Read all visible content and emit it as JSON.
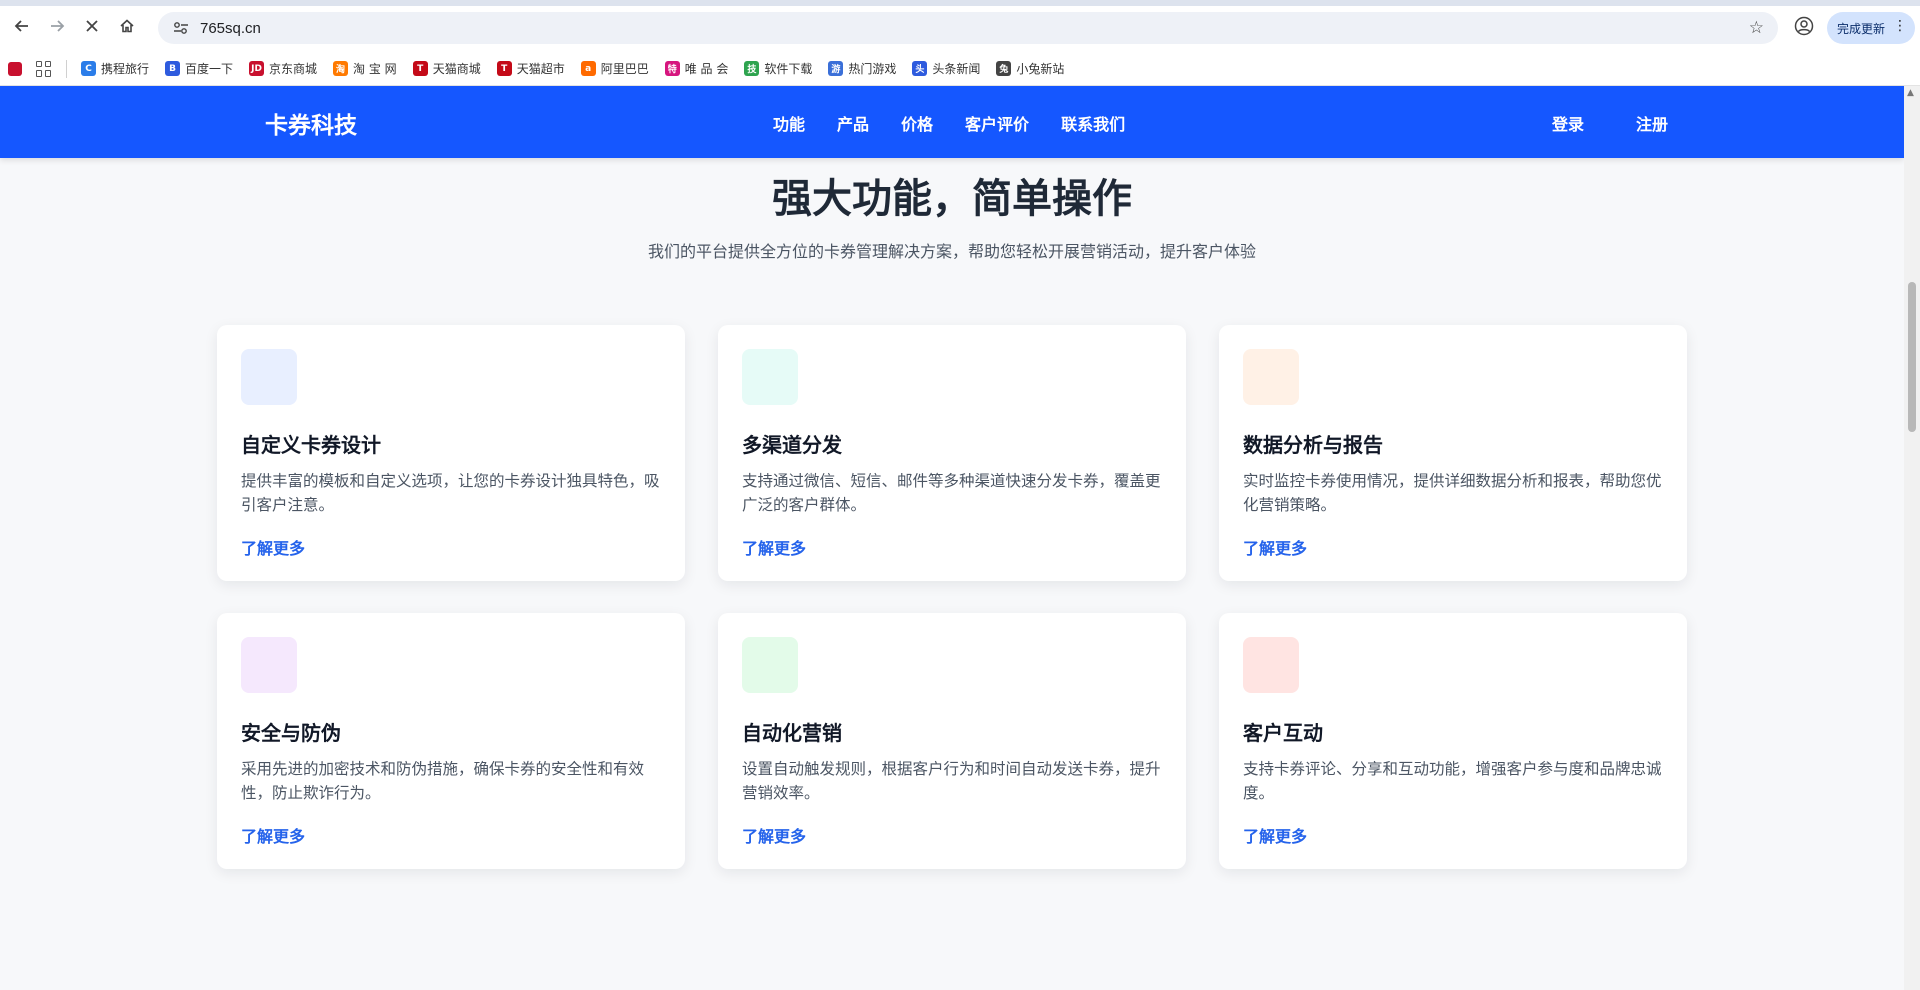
{
  "browser": {
    "url": "765sq.cn",
    "update_label": "完成更新"
  },
  "bookmarks": [
    {
      "label": "携程旅行",
      "color": "#2b7de9",
      "glyph": "C"
    },
    {
      "label": "百度一下",
      "color": "#2e5bde",
      "glyph": "B"
    },
    {
      "label": "京东商城",
      "color": "#c8102e",
      "glyph": "JD"
    },
    {
      "label": "淘 宝 网",
      "color": "#ff7a00",
      "glyph": "淘"
    },
    {
      "label": "天猫商城",
      "color": "#c40a18",
      "glyph": "T"
    },
    {
      "label": "天猫超市",
      "color": "#c40a18",
      "glyph": "T"
    },
    {
      "label": "阿里巴巴",
      "color": "#ff6a00",
      "glyph": "a"
    },
    {
      "label": "唯 品 会",
      "color": "#d6157e",
      "glyph": "特"
    },
    {
      "label": "软件下载",
      "color": "#2ea44f",
      "glyph": "技"
    },
    {
      "label": "热门游戏",
      "color": "#3a6fd8",
      "glyph": "游"
    },
    {
      "label": "头条新闻",
      "color": "#2e5bde",
      "glyph": "头"
    },
    {
      "label": "小兔新站",
      "color": "#444444",
      "glyph": "兔"
    }
  ],
  "site": {
    "brand": "卡券科技",
    "nav": [
      "功能",
      "产品",
      "价格",
      "客户评价",
      "联系我们"
    ],
    "login": "登录",
    "register": "注册"
  },
  "section": {
    "title": "强大功能，简单操作",
    "subtitle": "我们的平台提供全方位的卡券管理解决方案，帮助您轻松开展营销活动，提升客户体验"
  },
  "features": [
    {
      "title": "自定义卡券设计",
      "desc": "提供丰富的模板和自定义选项，让您的卡券设计独具特色，吸引客户注意。",
      "link": "了解更多",
      "icon_color": "#e8efff"
    },
    {
      "title": "多渠道分发",
      "desc": "支持通过微信、短信、邮件等多种渠道快速分发卡券，覆盖更广泛的客户群体。",
      "link": "了解更多",
      "icon_color": "#e6fbf7"
    },
    {
      "title": "数据分析与报告",
      "desc": "实时监控卡券使用情况，提供详细数据分析和报表，帮助您优化营销策略。",
      "link": "了解更多",
      "icon_color": "#fff1e6"
    },
    {
      "title": "安全与防伪",
      "desc": "采用先进的加密技术和防伪措施，确保卡券的安全性和有效性，防止欺诈行为。",
      "link": "了解更多",
      "icon_color": "#f5e8fd"
    },
    {
      "title": "自动化营销",
      "desc": "设置自动触发规则，根据客户行为和时间自动发送卡券，提升营销效率。",
      "link": "了解更多",
      "icon_color": "#e3fbe9"
    },
    {
      "title": "客户互动",
      "desc": "支持卡券评论、分享和互动功能，增强客户参与度和品牌忠诚度。",
      "link": "了解更多",
      "icon_color": "#ffe4e2"
    }
  ]
}
